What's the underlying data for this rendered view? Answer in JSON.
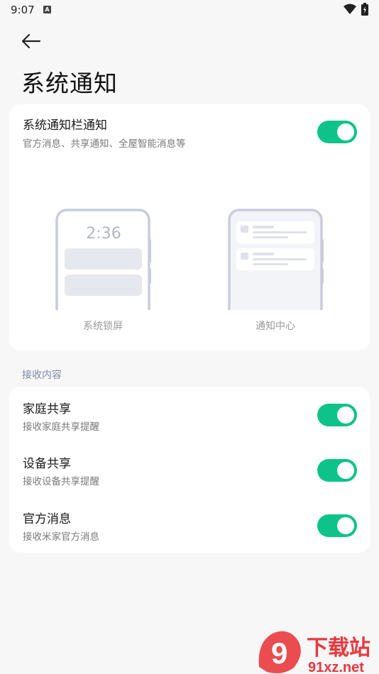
{
  "status": {
    "time": "9:07",
    "notification_icon": "A"
  },
  "header": {
    "title": "系统通知"
  },
  "system_card": {
    "title": "系统通知栏通知",
    "subtitle": "官方消息、共享通知、全屋智能消息等",
    "toggle_on": true,
    "lock_screen": {
      "clock": "2:36",
      "label": "系统锁屏"
    },
    "notification_center": {
      "label": "通知中心"
    }
  },
  "section": {
    "label": "接收内容"
  },
  "items": [
    {
      "title": "家庭共享",
      "subtitle": "接收家庭共享提醒",
      "toggle_on": true
    },
    {
      "title": "设备共享",
      "subtitle": "接收设备共享提醒",
      "toggle_on": true
    },
    {
      "title": "官方消息",
      "subtitle": "接收米家官方消息",
      "toggle_on": true
    }
  ],
  "watermark": {
    "brand": "9",
    "text": "下载站",
    "domain": "91xz.net"
  },
  "colors": {
    "accent": "#0ec38a",
    "background": "#f7f7f7",
    "card": "#ffffff",
    "watermark": "#e8383d"
  }
}
